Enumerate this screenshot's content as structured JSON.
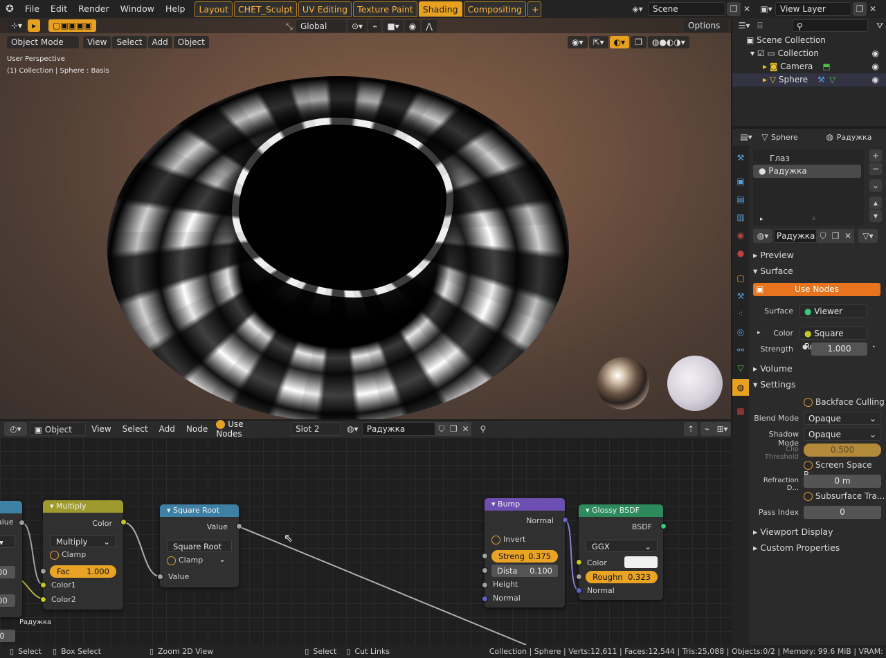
{
  "menu": [
    "File",
    "Edit",
    "Render",
    "Window",
    "Help"
  ],
  "workspaces": [
    {
      "label": "Layout",
      "active": false
    },
    {
      "label": "CHET_Sculpt",
      "active": false
    },
    {
      "label": "UV Editing",
      "active": false
    },
    {
      "label": "Texture Paint",
      "active": false
    },
    {
      "label": "Shading",
      "active": true
    },
    {
      "label": "Compositing",
      "active": false
    }
  ],
  "add_workspace": "+",
  "scene": {
    "value": "Scene"
  },
  "view_layer": {
    "value": "View Layer"
  },
  "viewport": {
    "transform_orientation": "Global",
    "options_label": "Options",
    "mode": "Object Mode",
    "menus": [
      "View",
      "Select",
      "Add",
      "Object"
    ],
    "overlay_title": "User Perspective",
    "overlay_subtitle": "(1) Collection | Sphere : Basis"
  },
  "outliner": {
    "root": "Scene Collection",
    "items": [
      {
        "label": "Collection"
      },
      {
        "label": "Camera"
      },
      {
        "label": "Sphere"
      }
    ]
  },
  "properties": {
    "object": "Sphere",
    "material": "Радужка",
    "slots": [
      {
        "label": "Глаз",
        "selected": false
      },
      {
        "label": "Радужка",
        "selected": true
      }
    ],
    "material_name": "Радужка",
    "sections": {
      "preview": "Preview",
      "surface": "Surface",
      "volume": "Volume",
      "settings": "Settings",
      "viewport_display": "Viewport Display",
      "custom_properties": "Custom Properties"
    },
    "use_nodes": "Use Nodes",
    "surface_label": "Surface",
    "surface_value": "Viewer",
    "color_label": "Color",
    "color_value": "Square Root",
    "strength_label": "Strength",
    "strength_value": "1.000",
    "backface_culling": "Backface Culling",
    "blend_mode_label": "Blend Mode",
    "blend_mode_value": "Opaque",
    "shadow_mode_label": "Shadow Mode",
    "shadow_mode_value": "Opaque",
    "clip_threshold_label": "Clip Threshold",
    "clip_threshold_value": "0.500",
    "screen_space": "Screen Space R...",
    "refraction_label": "Refraction D...",
    "refraction_value": "0 m",
    "subsurface": "Subsurface Tra...",
    "pass_index_label": "Pass Index",
    "pass_index_value": "0"
  },
  "node_editor": {
    "type": "Object",
    "menus": [
      "View",
      "Select",
      "Add",
      "Node"
    ],
    "use_nodes": "Use Nodes",
    "slot": "Slot 2",
    "material": "Радужка",
    "frame_label": "Радужка",
    "nodes": {
      "left_partial": {
        "out_label": "alue",
        "field1": "00",
        "field2": "00"
      },
      "multiply": {
        "title": "Multiply",
        "out": "Color",
        "op": "Multiply",
        "clamp": "Clamp",
        "fac_label": "Fac",
        "fac_value": "1.000",
        "in1": "Color1",
        "in2": "Color2"
      },
      "sqrt": {
        "title": "Square Root",
        "out": "Value",
        "op": "Square Root",
        "clamp": "Clamp",
        "in": "Value"
      },
      "bump": {
        "title": "Bump",
        "out": "Normal",
        "invert": "Invert",
        "strength_label": "Streng",
        "strength_value": "0.375",
        "distance_label": "Dista",
        "distance_value": "0.100",
        "height": "Height",
        "normal": "Normal"
      },
      "glossy": {
        "title": "Glossy BSDF",
        "out": "BSDF",
        "dist": "GGX",
        "color": "Color",
        "rough_label": "Roughn",
        "rough_value": "0.323",
        "normal": "Normal"
      }
    }
  },
  "status": {
    "left": [
      {
        "label": "Select"
      },
      {
        "label": "Box Select"
      },
      {
        "label": "Zoom 2D View"
      },
      {
        "label": "Select"
      },
      {
        "label": "Cut Links"
      }
    ],
    "stats": "Collection | Sphere | Verts:12,611 | Faces:12,544 | Tris:25,088 | Objects:0/2 | Memory: 99.6 MiB | VRAM: "
  },
  "colors": {
    "accent": "#e8a021",
    "node_converter": "#3e81a5",
    "node_color": "#9f9a2e",
    "node_vector": "#6c4fb0",
    "node_shader": "#2d8a5c"
  }
}
